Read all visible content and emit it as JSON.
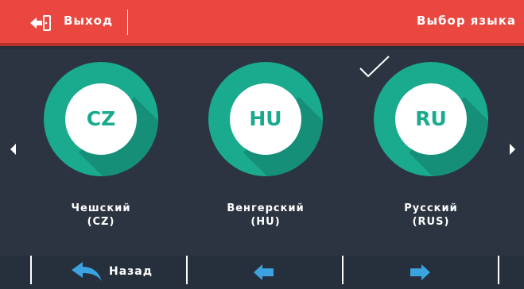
{
  "header": {
    "exit_label": "Выход",
    "title": "Выбор языка"
  },
  "languages": [
    {
      "code": "CZ",
      "name": "Чешский",
      "code_label": "(CZ)",
      "selected": false
    },
    {
      "code": "HU",
      "name": "Венгерский",
      "code_label": "(HU)",
      "selected": false
    },
    {
      "code": "RU",
      "name": "Русский",
      "code_label": "(RUS)",
      "selected": true
    }
  ],
  "footer": {
    "back_label": "Назад"
  },
  "colors": {
    "header_bg": "#e9473f",
    "background": "#26303d",
    "accent": "#1aaa8d",
    "accent_light": "#2fc7a4",
    "icon_blue": "#3aa3e0"
  },
  "icons": {
    "exit": "exit-door-icon",
    "back": "back-arrow-icon",
    "prev": "left-arrow-icon",
    "next": "right-arrow-icon",
    "check": "checkmark-icon"
  }
}
